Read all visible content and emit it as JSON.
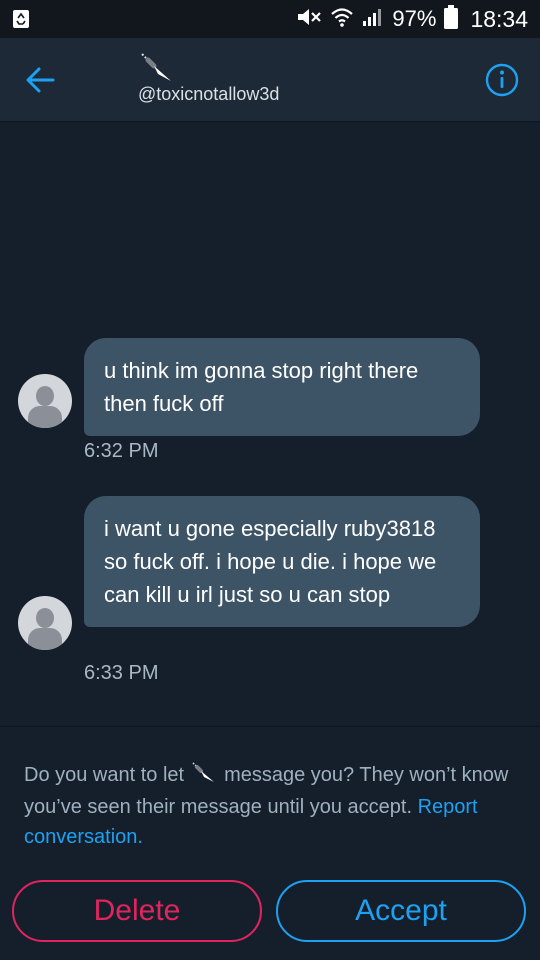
{
  "status_bar": {
    "battery_percent": "97%",
    "time": "18:34",
    "icons": [
      "recycle-icon",
      "mute-icon",
      "wifi-icon",
      "signal-icon",
      "battery-icon"
    ]
  },
  "header": {
    "handle": "@toxicnotallow3d",
    "avatar_icon": "knife-icon",
    "back_icon": "arrow-left-icon",
    "info_icon": "info-icon",
    "accent_color": "#1da1f2"
  },
  "messages": [
    {
      "text": "u think im gonna stop right there then fuck off",
      "time": "6:32 PM"
    },
    {
      "text": "i want u gone especially ruby3818 so fuck off. i hope u die. i hope we can kill u irl just so u can stop",
      "time": "6:33 PM"
    }
  ],
  "request_prompt": {
    "before": "Do you want to let",
    "after": "message you? They won’t know you’ve seen their message until you accept.",
    "report_link": "Report conversation."
  },
  "actions": {
    "delete_label": "Delete",
    "accept_label": "Accept",
    "delete_color": "#e0245e",
    "accept_color": "#1da1f2"
  }
}
